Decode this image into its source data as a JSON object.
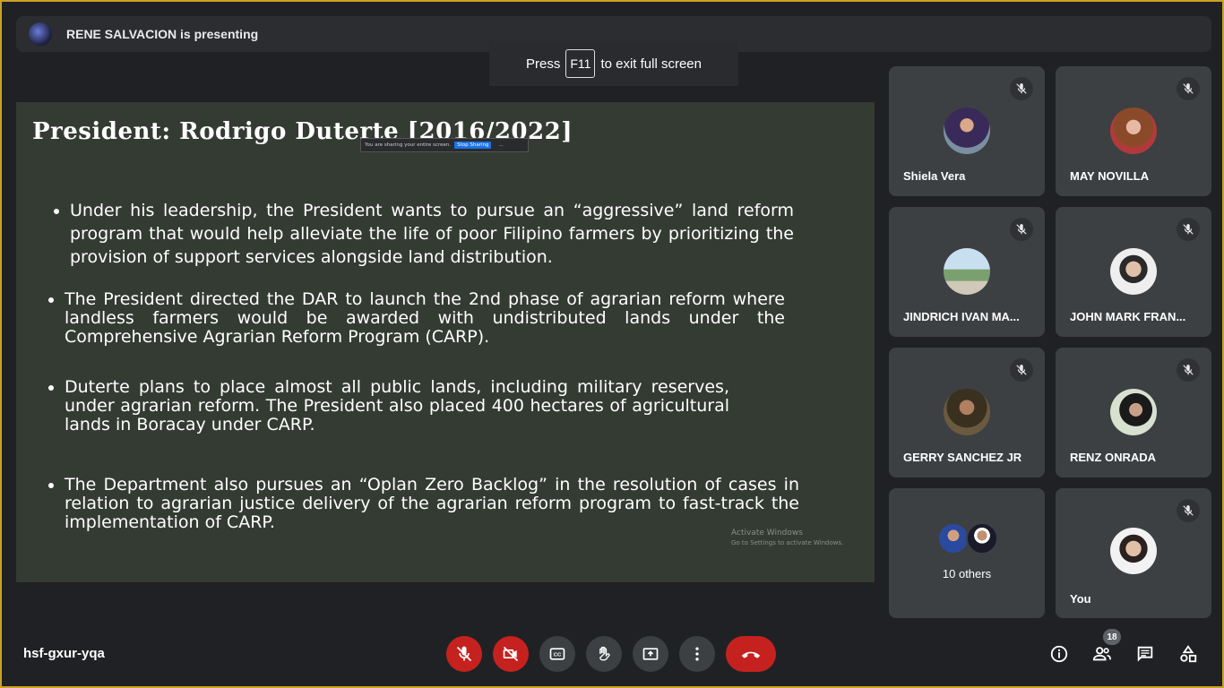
{
  "header": {
    "presenting_text": "RENE SALVACION is presenting"
  },
  "fullscreen_toast": {
    "prefix": "Press",
    "key": "F11",
    "suffix": "to exit full screen"
  },
  "slide": {
    "title": "President: Rodrigo Duterte [2016/2022]",
    "sharing_bar": {
      "text": "You are sharing your entire screen.",
      "stop_label": "Stop Sharing",
      "more": "..."
    },
    "bullets": [
      "Under his leadership, the President wants to pursue an “aggressive” land reform program that would help alleviate the life of poor Filipino farmers by prioritizing the provision of support services alongside land distribution.",
      "The President directed the DAR to launch the 2nd phase of agrarian reform where landless farmers would be awarded with undistributed lands under the Comprehensive Agrarian Reform Program (CARP).",
      "Duterte plans to place almost all public lands, including military reserves, under agrarian reform. The President also placed 400 hectares of agricultural lands in Boracay under CARP.",
      "The Department also pursues an “Oplan Zero Backlog” in the resolution of cases in relation to agrarian justice delivery of the agrarian reform program to fast-track the implementation of CARP."
    ],
    "watermark": {
      "title": "Activate Windows",
      "subtitle": "Go to Settings to activate Windows."
    }
  },
  "participants": [
    {
      "name": "Shiela Vera",
      "muted": true
    },
    {
      "name": "MAY NOVILLA",
      "muted": true
    },
    {
      "name": "JINDRICH IVAN MA...",
      "muted": true
    },
    {
      "name": "JOHN MARK FRAN...",
      "muted": true
    },
    {
      "name": "GERRY SANCHEZ JR",
      "muted": true
    },
    {
      "name": "RENZ ONRADA",
      "muted": true
    },
    {
      "name": "You",
      "muted": true
    }
  ],
  "others": {
    "label": "10 others"
  },
  "bottom": {
    "meeting_code": "hsf-gxur-yqa",
    "participant_count": "18"
  },
  "colors": {
    "danger": "#c5221f",
    "tile": "#3c4043",
    "background": "#202124",
    "slide_bg": "#343b33"
  }
}
